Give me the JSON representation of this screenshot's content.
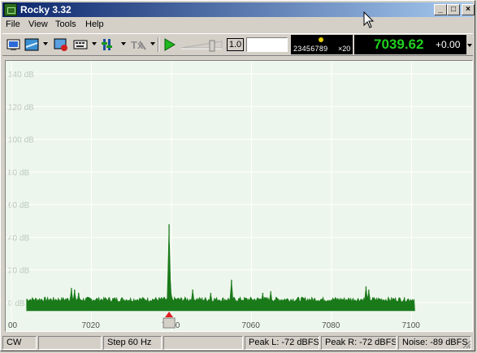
{
  "window": {
    "title": "Rocky 3.32",
    "caption_buttons": {
      "minimize": "_",
      "maximize": "□",
      "close": "×"
    }
  },
  "menu": [
    {
      "label": "File"
    },
    {
      "label": "View"
    },
    {
      "label": "Tools"
    },
    {
      "label": "Help"
    }
  ],
  "toolbar": {
    "icons": [
      "monitor-icon",
      "spectrum-icon",
      "record-icon",
      "keyboard-icon",
      "equalizer-icon",
      "transmit-icon",
      "play-icon"
    ],
    "tx_label": "Tx",
    "speed_value": "1.0",
    "text_input_value": "",
    "digits_display": {
      "digits": "23456789",
      "step": "×20"
    },
    "frequency": {
      "main": "7039.62",
      "offset": "+0.00"
    }
  },
  "chart_data": {
    "type": "area",
    "title": "",
    "xlabel": "",
    "ylabel": "",
    "x_ticks": [
      "00",
      "7020",
      "7040",
      "7060",
      "7080",
      "7100"
    ],
    "y_ticks": [
      "0 dB",
      "20 dB",
      "40 dB",
      "60 dB",
      "80 dB",
      "100 dB",
      "120 dB",
      "140 dB"
    ],
    "xlim": [
      7000,
      7108
    ],
    "ylim": [
      -5,
      150
    ],
    "grid": true,
    "noise_floor_db": 4,
    "series": [
      {
        "color": "#1a7a1a",
        "peaks": [
          {
            "x": 7015.2,
            "y": 11
          },
          {
            "x": 7016.0,
            "y": 10
          },
          {
            "x": 7017.0,
            "y": 8
          },
          {
            "x": 7039.6,
            "y": 50
          },
          {
            "x": 7039.9,
            "y": 14
          },
          {
            "x": 7045.5,
            "y": 10
          },
          {
            "x": 7050.0,
            "y": 8
          },
          {
            "x": 7055.2,
            "y": 16
          },
          {
            "x": 7063.0,
            "y": 8
          },
          {
            "x": 7065.0,
            "y": 9
          },
          {
            "x": 7088.8,
            "y": 12
          },
          {
            "x": 7089.5,
            "y": 10
          }
        ]
      }
    ],
    "marker_x": 7039.6
  },
  "status": {
    "mode": "CW",
    "blank1": "",
    "step": "Step 60 Hz",
    "blank2": "",
    "peak_l": "Peak L: -72 dBFS",
    "peak_r": "Peak R: -72 dBFS",
    "noise": "Noise: -89 dBFS"
  }
}
